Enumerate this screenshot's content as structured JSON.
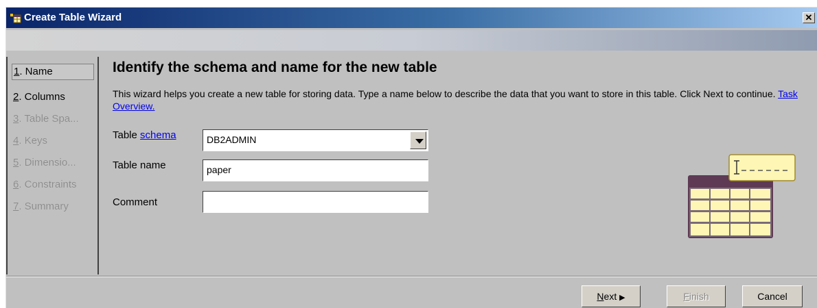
{
  "window": {
    "title": "Create Table Wizard",
    "close_glyph": "✕"
  },
  "steps": [
    {
      "num": "1",
      "label": ". Name",
      "state": "selected"
    },
    {
      "num": "2",
      "label": ". Columns",
      "state": "enabled"
    },
    {
      "num": "3",
      "label": ". Table Spa...",
      "state": "disabled"
    },
    {
      "num": "4",
      "label": ". Keys",
      "state": "disabled"
    },
    {
      "num": "5",
      "label": ". Dimensio...",
      "state": "disabled"
    },
    {
      "num": "6",
      "label": ". Constraints",
      "state": "disabled"
    },
    {
      "num": "7",
      "label": ". Summary",
      "state": "disabled"
    }
  ],
  "main": {
    "title": "Identify the schema and name for the new table",
    "description": "This wizard helps you create a new table for storing data. Type a name below to describe the data that you want to store in this table. Click Next to continue.",
    "task_link": "Task Overview."
  },
  "form": {
    "schema_label": "Table",
    "schema_link": "schema",
    "schema_value": "DB2ADMIN",
    "name_label": "Table name",
    "name_value": "paper",
    "comment_label": "Comment",
    "comment_value": ""
  },
  "buttons": {
    "next_mnemonic": "N",
    "next_rest": "ext",
    "next_arrow": "▶",
    "finish_mnemonic": "F",
    "finish_rest": "inish",
    "cancel": "Cancel"
  },
  "colors": {
    "titlebar": "#0a246a",
    "link": "#0000ee",
    "dialog_bg": "#c0c0c0",
    "illustration_header": "#5e3a55",
    "illustration_cells": "#fdf6b4"
  },
  "icons": [
    "wizard-title-icon",
    "close-icon",
    "dropdown-arrow-icon",
    "table-illustration-icon"
  ]
}
